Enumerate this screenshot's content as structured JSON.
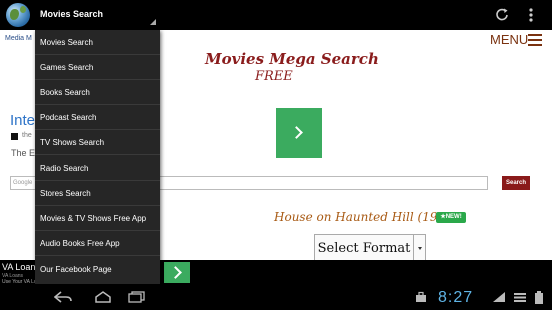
{
  "action_bar": {
    "app_icon": "globe-icon",
    "spinner_label": "Movies Search",
    "refresh_icon": "refresh-icon",
    "overflow_icon": "overflow-menu-icon"
  },
  "dropdown": {
    "items": [
      "Movies Search",
      "Games Search",
      "Books Search",
      "Podcast Search",
      "TV Shows Search",
      "Radio Search",
      "Stores Search",
      "Movies & TV Shows Free App",
      "Audio Books Free App",
      "Our Facebook Page"
    ]
  },
  "web": {
    "media_link": "Media M",
    "menu_label": "MENU",
    "brand_title": "Movies Mega Search",
    "brand_sub": "FREE",
    "ad_headline": "Inte                              ame",
    "ad_small": "the",
    "ad_desc": "The E                                       Returns. Watch the Trailer",
    "search_placeholder": "Google",
    "search_button": "Search",
    "movie_title": "House on Haunted Hill (1959)",
    "new_badge": "★NEW!",
    "select_button": "Select Format"
  },
  "bottom_ad": {
    "title": "VA Loans",
    "line2": "VA Loans",
    "line3": "Use Your VA Loan"
  },
  "system": {
    "time": "8:27",
    "colors": {
      "accent": "#5fb4e6",
      "ad_green": "#3bab5f",
      "brand": "#8a1c1c"
    }
  }
}
